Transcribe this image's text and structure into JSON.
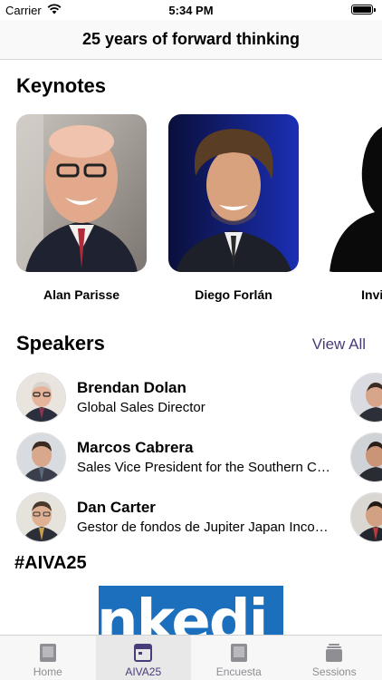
{
  "status": {
    "carrier": "Carrier",
    "time": "5:34 PM",
    "battery_level": 1.0
  },
  "nav": {
    "title": "25 years of forward thinking"
  },
  "keynotes": {
    "title": "Keynotes",
    "items": [
      {
        "name": "Alan Parisse"
      },
      {
        "name": "Diego Forlán"
      },
      {
        "name": "Invitado"
      }
    ]
  },
  "speakers": {
    "title": "Speakers",
    "view_all": "View All",
    "items": [
      {
        "name": "Brendan Dolan",
        "title": "Global Sales Director"
      },
      {
        "name": "Marcos Cabrera",
        "title": "Sales Vice President for the Southern Cone"
      },
      {
        "name": "Dan Carter",
        "title": "Gestor de fondos de Jupiter Japan Income Fund"
      }
    ]
  },
  "hashtag": {
    "title": "#AIVA25"
  },
  "banner": {
    "text": "nkedi"
  },
  "tabs": [
    {
      "label": "Home",
      "icon": "page-icon",
      "active": false
    },
    {
      "label": "AIVA25",
      "icon": "calendar-icon",
      "active": true
    },
    {
      "label": "Encuesta",
      "icon": "page-icon",
      "active": false
    },
    {
      "label": "Sessions",
      "icon": "stack-icon",
      "active": false
    }
  ],
  "colors": {
    "accent": "#4a3b7a",
    "banner": "#1b6fbc",
    "tab_inactive": "#8e8e93"
  }
}
